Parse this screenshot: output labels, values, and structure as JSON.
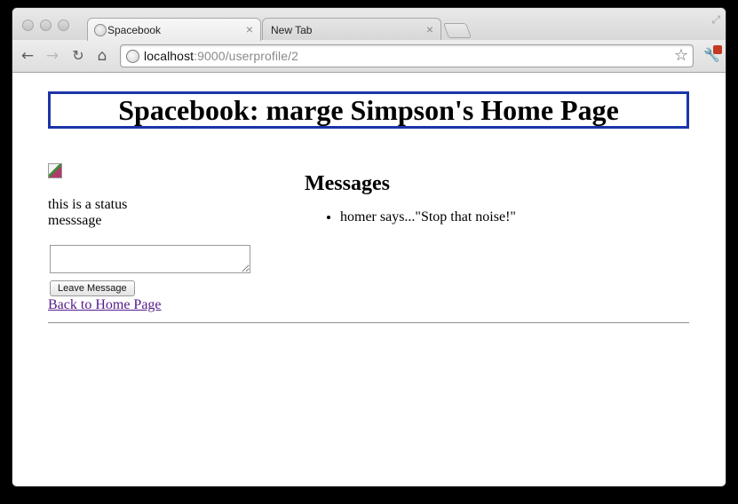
{
  "browser": {
    "tabs": [
      {
        "label": "Spacebook",
        "active": true
      },
      {
        "label": "New Tab",
        "active": false
      }
    ],
    "tab_close_glyph": "×",
    "address": {
      "host": "localhost",
      "path": ":9000/userprofile/2"
    },
    "icons": {
      "back": "back-arrow-icon",
      "forward": "forward-arrow-icon",
      "reload": "reload-icon",
      "home": "home-icon",
      "bookmark": "star-icon",
      "menu": "wrench-icon"
    }
  },
  "page": {
    "header_title": "Spacebook: marge Simpson's Home Page",
    "status_message": "this is a status messsage",
    "message_input_value": "",
    "leave_message_label": "Leave Message",
    "back_link_label": "Back to Home Page",
    "messages_heading": "Messages",
    "messages": [
      "homer says...\"Stop that noise!\""
    ]
  },
  "colors": {
    "header_border": "#1b35a8",
    "visited_link": "#551a8b"
  }
}
